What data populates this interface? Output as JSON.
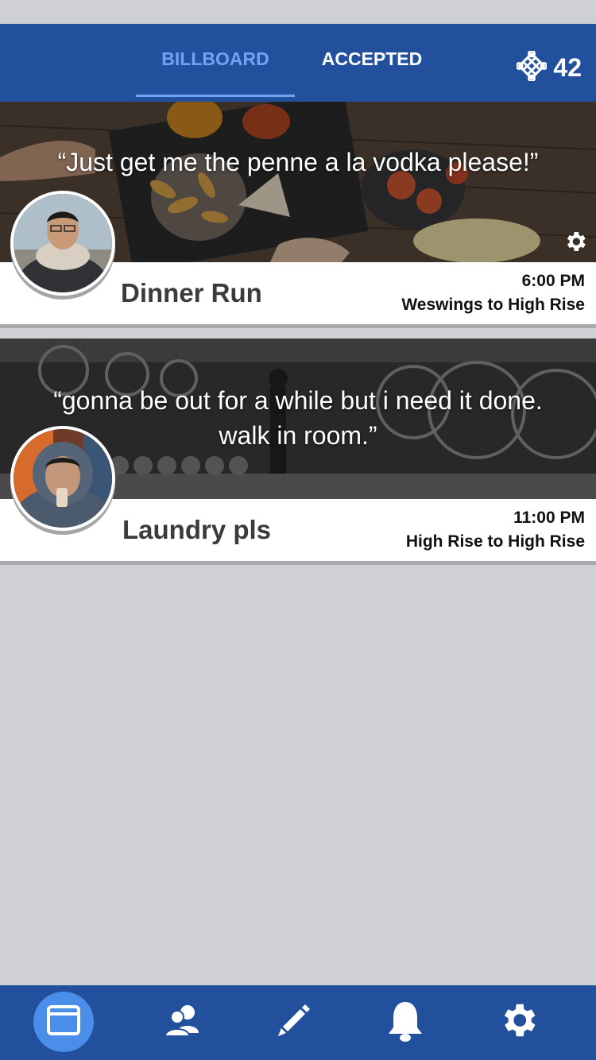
{
  "header": {
    "tabs": [
      {
        "label": "BILLBOARD",
        "active": true
      },
      {
        "label": "ACCEPTED",
        "active": false
      }
    ],
    "credits": "42"
  },
  "cards": [
    {
      "quote": "“Just get me the penne a la vodka please!”",
      "title": "Dinner Run",
      "time": "6:00 PM",
      "route": "Weswings to High Rise"
    },
    {
      "quote": "“gonna be out for a while but i need it done. walk in room.”",
      "title": "Laundry pls",
      "time": "11:00 PM",
      "route": "High Rise to High Rise"
    }
  ],
  "tabbar": {
    "items": [
      "billboard-icon",
      "contacts-icon",
      "pencil-icon",
      "bell-icon",
      "gear-icon"
    ],
    "active": "billboard-icon"
  },
  "colors": {
    "primary": "#23509d",
    "accent": "#6fa4f2",
    "background": "#cfd0d3"
  }
}
